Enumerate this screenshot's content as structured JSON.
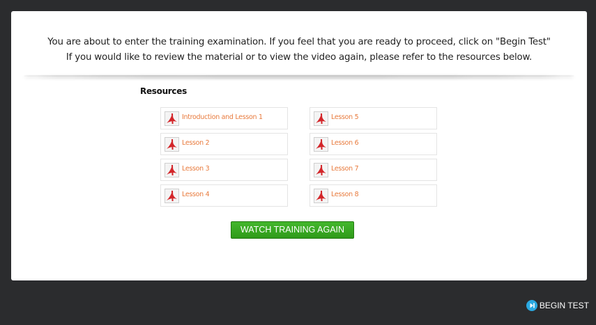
{
  "intro": {
    "line1": "You are about to enter the training examination. If you feel that you are ready to proceed, click on \"Begin Test\"",
    "line2": "If you would like to review the material or to view the video again, please refer to the resources below."
  },
  "resources": {
    "title": "Resources",
    "items": [
      {
        "label": "Introduction and Lesson 1",
        "icon": "pdf-icon"
      },
      {
        "label": "Lesson 5",
        "icon": "pdf-icon"
      },
      {
        "label": "Lesson 2",
        "icon": "pdf-icon"
      },
      {
        "label": "Lesson 6",
        "icon": "pdf-icon"
      },
      {
        "label": "Lesson 3",
        "icon": "pdf-icon"
      },
      {
        "label": "Lesson 7",
        "icon": "pdf-icon"
      },
      {
        "label": "Lesson 4",
        "icon": "pdf-icon"
      },
      {
        "label": "Lesson 8",
        "icon": "pdf-icon"
      }
    ],
    "link_color": "#e87a3c"
  },
  "watch_button": {
    "label": "WATCH TRAINING AGAIN",
    "color": "#3aa824"
  },
  "begin_test": {
    "label": "BEGIN TEST",
    "icon": "next-track-icon",
    "icon_color": "#2aa8e0"
  }
}
